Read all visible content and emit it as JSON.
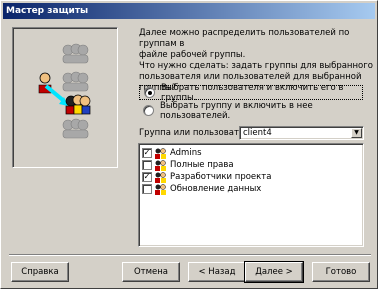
{
  "window": {
    "title": "Мастер защиты"
  },
  "intro_text": [
    "Далее можно распределить пользователей по группам в",
    "файле рабочей группы."
  ],
  "question_text": [
    "Что нужно сделать: задать группы для выбранного",
    "пользователя или пользователей для выбранной группы?"
  ],
  "options": [
    {
      "label": "Выбрать пользователя и включить его в группы.",
      "selected": true
    },
    {
      "label": "Выбрать группу и включить в нее пользователей.",
      "selected": false
    }
  ],
  "group_user": {
    "label": "Группа или пользователь:",
    "value": "client4"
  },
  "groups": [
    {
      "name": "Admins",
      "checked": true
    },
    {
      "name": "Полные права",
      "checked": false
    },
    {
      "name": "Разработчики проекта",
      "checked": true
    },
    {
      "name": "Обновление данных",
      "checked": false
    }
  ],
  "buttons": {
    "help": "Справка",
    "cancel": "Отмена",
    "back": "< Назад",
    "next": "Далее >",
    "finish": "Готово"
  },
  "colors": {
    "titlebar_start": "#0a246a",
    "titlebar_end": "#a6caf0",
    "arrow": "#00e5ff"
  }
}
